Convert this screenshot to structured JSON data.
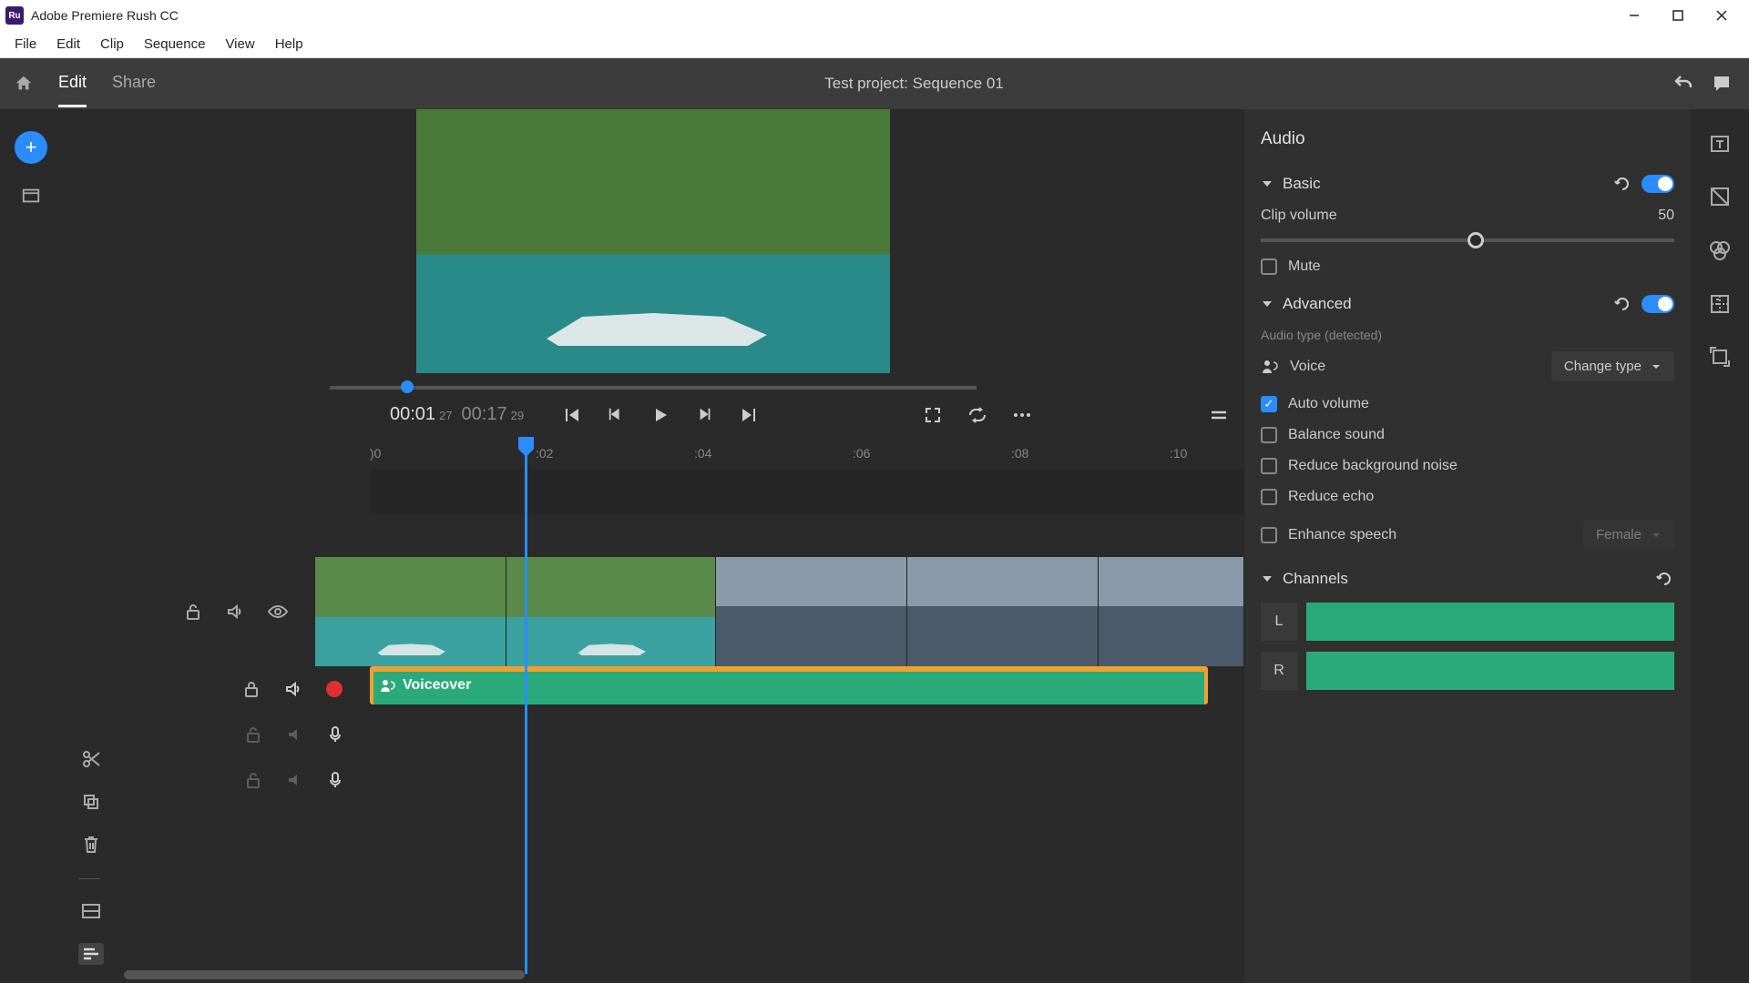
{
  "titlebar": {
    "app_name": "Adobe Premiere Rush CC"
  },
  "menubar": {
    "items": [
      "File",
      "Edit",
      "Clip",
      "Sequence",
      "View",
      "Help"
    ]
  },
  "toolbar": {
    "tabs": {
      "edit": "Edit",
      "share": "Share"
    },
    "project_title": "Test project: Sequence 01"
  },
  "preview": {
    "current_time": "00:01",
    "current_frames": "27",
    "duration": "00:17",
    "duration_frames": "29"
  },
  "ruler": {
    "ticks": [
      ")0",
      ":02",
      ":04",
      ":06",
      ":08",
      ":10"
    ]
  },
  "timeline": {
    "voiceover_label": "Voiceover"
  },
  "panel": {
    "title": "Audio",
    "basic": {
      "title": "Basic",
      "clip_volume_label": "Clip volume",
      "clip_volume_value": "50",
      "mute_label": "Mute"
    },
    "advanced": {
      "title": "Advanced",
      "detected_label": "Audio type (detected)",
      "voice_label": "Voice",
      "change_type": "Change type",
      "auto_volume": "Auto volume",
      "balance_sound": "Balance sound",
      "reduce_noise": "Reduce background noise",
      "reduce_echo": "Reduce echo",
      "enhance_speech": "Enhance speech",
      "enhance_option": "Female"
    },
    "channels": {
      "title": "Channels",
      "left": "L",
      "right": "R"
    }
  }
}
